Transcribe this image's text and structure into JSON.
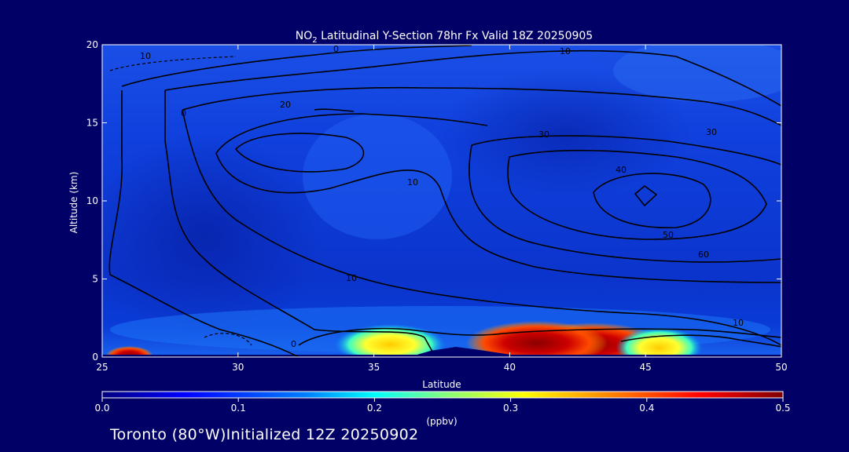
{
  "chart_data": {
    "type": "heatmap",
    "title_prefix": "NO",
    "title_sub": "2",
    "title_rest": " Latitudinal Y-Section 78hr  Fx Valid 18Z 20250905",
    "xlabel": "Latitude",
    "ylabel": "Altitude (km)",
    "xlim": [
      25,
      50
    ],
    "ylim": [
      0,
      20
    ],
    "x_ticks": [
      "25",
      "30",
      "35",
      "40",
      "45",
      "50"
    ],
    "y_ticks": [
      "0",
      "5",
      "10",
      "15",
      "20"
    ],
    "colorbar": {
      "label": "(ppbv)",
      "range": [
        0.0,
        0.5
      ],
      "ticks": [
        "0.0",
        "0.1",
        "0.2",
        "0.3",
        "0.4",
        "0.5"
      ],
      "colors": [
        "#00007f",
        "#0000ff",
        "#0080ff",
        "#00ffff",
        "#80ff80",
        "#ffff00",
        "#ff8000",
        "#ff0000",
        "#7f0000"
      ]
    },
    "contour_labels": [
      "0",
      "10",
      "10",
      "20",
      "30",
      "30",
      "40",
      "50",
      "60",
      "10",
      "10",
      "10",
      "0",
      "0"
    ],
    "hotspots": [
      {
        "lat": 26.0,
        "alt": 0.1,
        "value": 0.5
      },
      {
        "lat": 35.6,
        "alt": 0.8,
        "value": 0.22
      },
      {
        "lat": 43.0,
        "alt": 0.8,
        "value": 0.48
      },
      {
        "lat": 41.0,
        "alt": 0.9,
        "value": 0.42
      },
      {
        "lat": 45.5,
        "alt": 0.6,
        "value": 0.35
      }
    ]
  },
  "footer": {
    "location": "Toronto (80°W)",
    "initialized": "Initialized 12Z 20250902"
  }
}
